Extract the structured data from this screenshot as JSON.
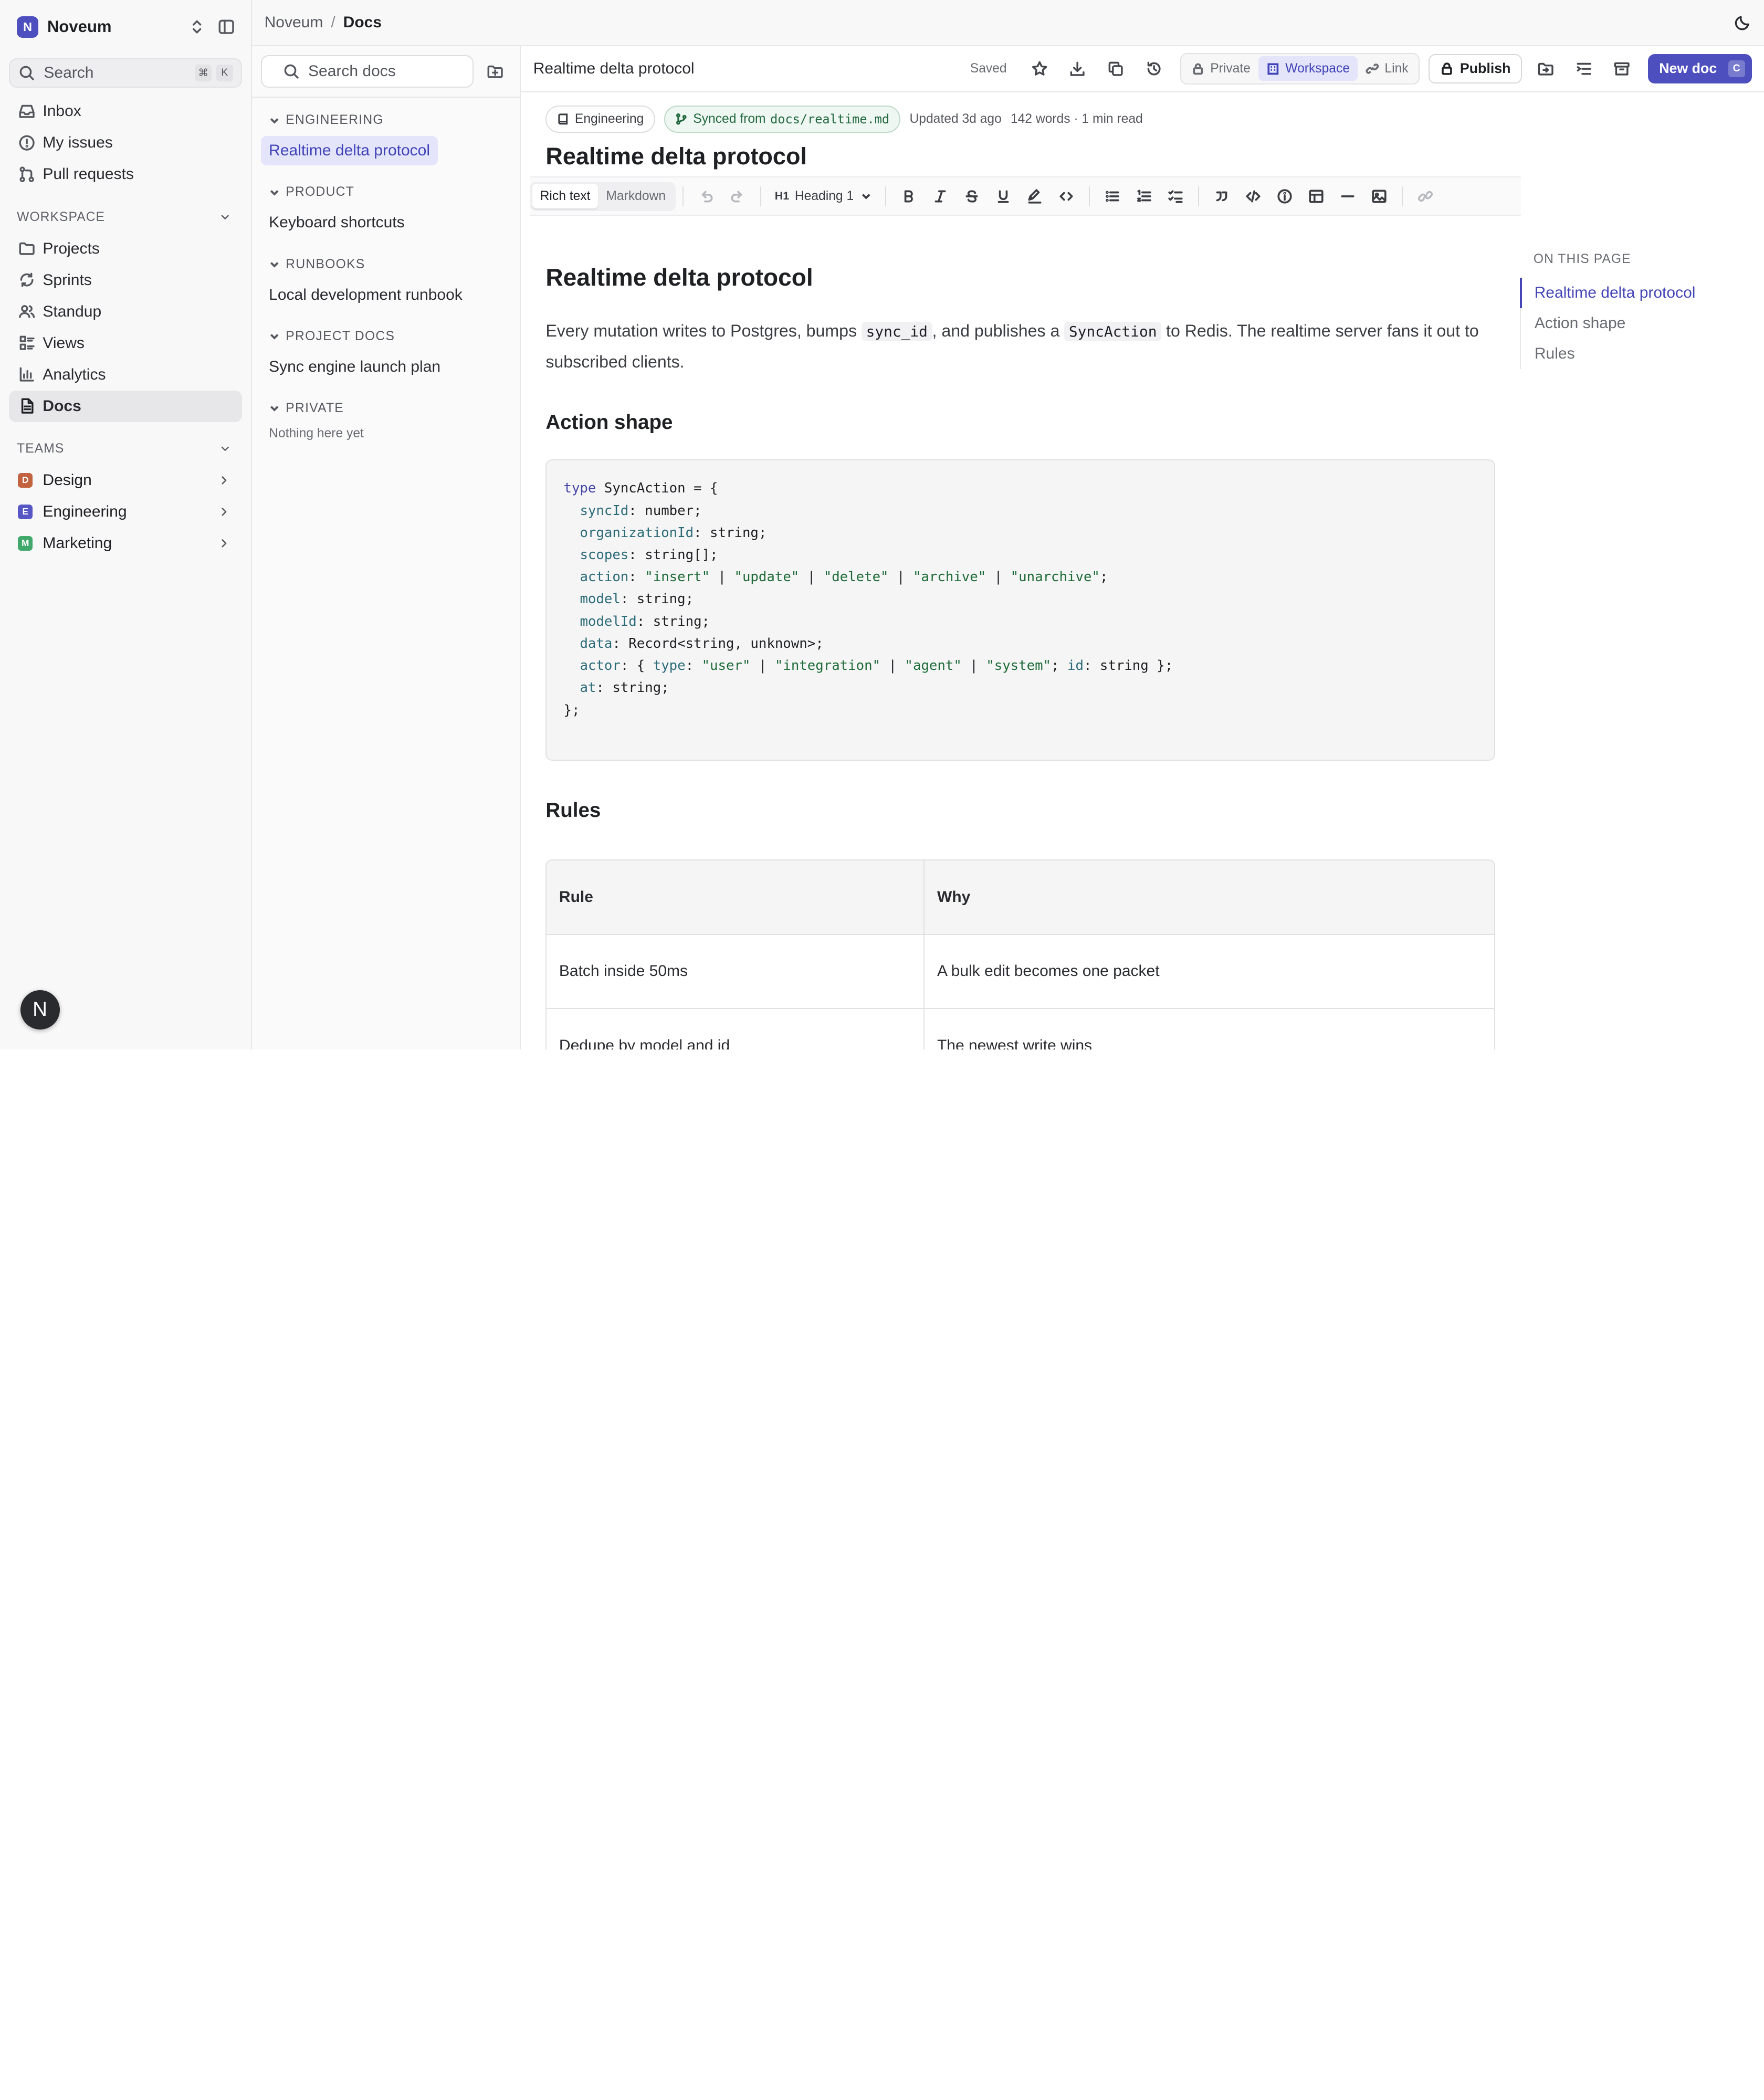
{
  "workspace": {
    "initial": "N",
    "name": "Noveum"
  },
  "search": {
    "placeholder": "Search",
    "k1": "⌘",
    "k2": "K"
  },
  "nav": {
    "inbox": "Inbox",
    "my_issues": "My issues",
    "pull_requests": "Pull requests"
  },
  "workspace_section": {
    "title": "WORKSPACE",
    "items": [
      "Projects",
      "Sprints",
      "Standup",
      "Views",
      "Analytics",
      "Docs"
    ]
  },
  "teams": {
    "title": "TEAMS",
    "items": [
      {
        "initial": "D",
        "name": "Design",
        "color": "#c2623f"
      },
      {
        "initial": "E",
        "name": "Engineering",
        "color": "#5656c4"
      },
      {
        "initial": "M",
        "name": "Marketing",
        "color": "#3fa86a"
      }
    ]
  },
  "user": {
    "initial": "N"
  },
  "breadcrumb": {
    "root": "Noveum",
    "sep": "/",
    "current": "Docs"
  },
  "tree": {
    "search_placeholder": "Search docs",
    "groups": [
      {
        "title": "ENGINEERING",
        "items": [
          "Realtime delta protocol"
        ]
      },
      {
        "title": "PRODUCT",
        "items": [
          "Keyboard shortcuts"
        ]
      },
      {
        "title": "RUNBOOKS",
        "items": [
          "Local development runbook"
        ]
      },
      {
        "title": "PROJECT DOCS",
        "items": [
          "Sync engine launch plan"
        ]
      },
      {
        "title": "PRIVATE",
        "empty": "Nothing here yet"
      }
    ]
  },
  "docbar": {
    "title": "Realtime delta protocol",
    "saved": "Saved",
    "visibility": [
      "Private",
      "Workspace",
      "Link"
    ],
    "publish": "Publish",
    "new_doc": "New doc",
    "new_doc_key": "C"
  },
  "meta": {
    "team": "Engineering",
    "synced_prefix": "Synced from",
    "synced_path": "docs/realtime.md",
    "updated": "Updated 3d ago",
    "stats": "142 words · 1 min read"
  },
  "doc": {
    "title": "Realtime delta protocol"
  },
  "toolbar": {
    "rich": "Rich text",
    "markdown": "Markdown",
    "heading_icon": "H1",
    "heading": "Heading 1"
  },
  "article": {
    "h1": "Realtime delta protocol",
    "p1a": "Every mutation writes to Postgres, bumps ",
    "c1": "sync_id",
    "p1b": ", and publishes a ",
    "c2": "SyncAction",
    "p1c": " to Redis. The realtime server fans it out to subscribed clients.",
    "h2a": "Action shape",
    "h2b": "Rules",
    "table": {
      "head": [
        "Rule",
        "Why"
      ],
      "rows": [
        [
          "Batch inside 50ms",
          "A bulk edit becomes one packet"
        ],
        [
          "Dedupe by model and id",
          "The newest write wins"
        ]
      ]
    }
  },
  "toc": {
    "title": "ON THIS PAGE",
    "items": [
      "Realtime delta protocol",
      "Action shape",
      "Rules"
    ]
  }
}
